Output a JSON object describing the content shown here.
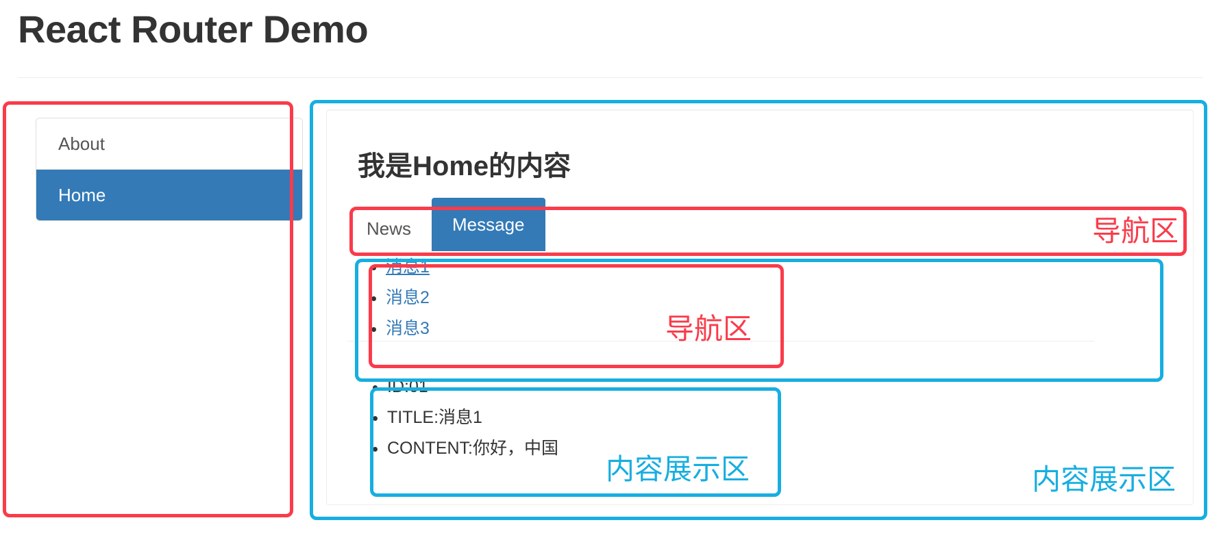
{
  "page": {
    "title": "React Router Demo"
  },
  "sidebar": {
    "items": [
      {
        "label": "About",
        "active": false
      },
      {
        "label": "Home",
        "active": true
      }
    ]
  },
  "content": {
    "heading": "我是Home的内容",
    "tabs": [
      {
        "label": "News",
        "active": false
      },
      {
        "label": "Message",
        "active": true
      }
    ],
    "messages": [
      {
        "label": "消息1",
        "current": true
      },
      {
        "label": "消息2",
        "current": false
      },
      {
        "label": "消息3",
        "current": false
      }
    ],
    "detail": [
      "ID:01",
      "TITLE:消息1",
      "CONTENT:你好，中国"
    ]
  },
  "annotations": {
    "nav_area_tabs": "导航区",
    "nav_area_messages": "导航区",
    "content_area_detail": "内容展示区",
    "content_area_panel": "内容展示区"
  },
  "colors": {
    "accent_blue": "#337ab7",
    "annotation_red": "#fa3b4a",
    "annotation_blue": "#17aee0",
    "text": "#333333",
    "muted_text": "#555555"
  }
}
